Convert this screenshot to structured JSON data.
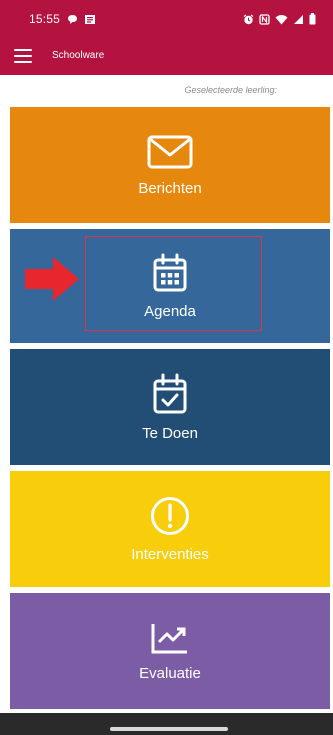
{
  "status_bar": {
    "time": "15:55",
    "left_icons": [
      "chat-bubble-icon",
      "message-app-icon"
    ],
    "right_icons": [
      "alarm-icon",
      "nfc-icon",
      "wifi-icon",
      "signal-icon",
      "battery-icon"
    ]
  },
  "app_bar": {
    "menu_icon": "hamburger-icon",
    "title": "Schoolware"
  },
  "subheader": {
    "selected_student_text": "Geselecteerde leerling:"
  },
  "tiles": [
    {
      "label": "Berichten",
      "icon": "envelope-icon",
      "color": "#e5880d"
    },
    {
      "label": "Agenda",
      "icon": "calendar-icon",
      "color": "#35679b"
    },
    {
      "label": "Te Doen",
      "icon": "calendar-check-icon",
      "color": "#224d74"
    },
    {
      "label": "Interventies",
      "icon": "exclamation-circle-icon",
      "color": "#f7cd0c"
    },
    {
      "label": "Evaluatie",
      "icon": "trend-chart-icon",
      "color": "#7d5ca6"
    }
  ],
  "colors": {
    "header": "#b5133f",
    "annotation": "#e8262d"
  }
}
